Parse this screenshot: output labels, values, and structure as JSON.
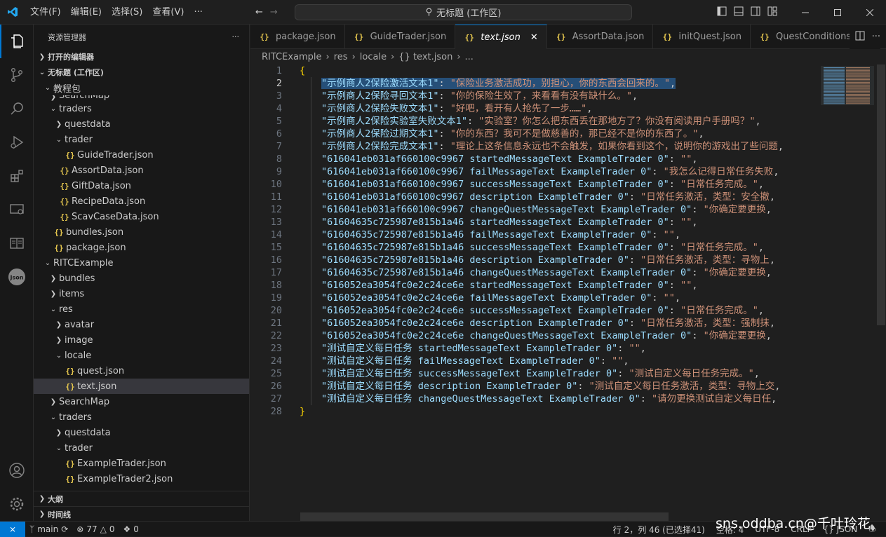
{
  "titlebar": {
    "menus": [
      "文件(F)",
      "编辑(E)",
      "选择(S)",
      "查看(V)",
      "···"
    ],
    "command_center": "无标题 (工作区)"
  },
  "sidebar": {
    "title": "资源管理器",
    "more": "···",
    "open_editors": "打开的编辑器",
    "workspace": "无标题 (工作区)",
    "tree": [
      {
        "label": "教程包",
        "kind": "folder",
        "open": true,
        "depth": 0
      },
      {
        "label": "SearchMap",
        "kind": "folder",
        "open": false,
        "depth": 1
      },
      {
        "label": "traders",
        "kind": "folder",
        "open": true,
        "depth": 1
      },
      {
        "label": "questdata",
        "kind": "folder",
        "open": false,
        "depth": 2
      },
      {
        "label": "trader",
        "kind": "folder",
        "open": true,
        "depth": 2
      },
      {
        "label": "GuideTrader.json",
        "kind": "json",
        "depth": 3
      },
      {
        "label": "AssortData.json",
        "kind": "json",
        "depth": 2
      },
      {
        "label": "GiftData.json",
        "kind": "json",
        "depth": 2
      },
      {
        "label": "RecipeData.json",
        "kind": "json",
        "depth": 2
      },
      {
        "label": "ScavCaseData.json",
        "kind": "json",
        "depth": 2
      },
      {
        "label": "bundles.json",
        "kind": "json",
        "depth": 1
      },
      {
        "label": "package.json",
        "kind": "json",
        "depth": 1
      },
      {
        "label": "RITCExample",
        "kind": "folder",
        "open": true,
        "depth": 0
      },
      {
        "label": "bundles",
        "kind": "folder",
        "open": false,
        "depth": 1
      },
      {
        "label": "items",
        "kind": "folder",
        "open": false,
        "depth": 1
      },
      {
        "label": "res",
        "kind": "folder",
        "open": true,
        "depth": 1
      },
      {
        "label": "avatar",
        "kind": "folder",
        "open": false,
        "depth": 2
      },
      {
        "label": "image",
        "kind": "folder",
        "open": false,
        "depth": 2
      },
      {
        "label": "locale",
        "kind": "folder",
        "open": true,
        "depth": 2
      },
      {
        "label": "quest.json",
        "kind": "json",
        "depth": 3
      },
      {
        "label": "text.json",
        "kind": "json",
        "depth": 3,
        "selected": true
      },
      {
        "label": "SearchMap",
        "kind": "folder",
        "open": false,
        "depth": 1
      },
      {
        "label": "traders",
        "kind": "folder",
        "open": true,
        "depth": 1
      },
      {
        "label": "questdata",
        "kind": "folder",
        "open": false,
        "depth": 2
      },
      {
        "label": "trader",
        "kind": "folder",
        "open": true,
        "depth": 2
      },
      {
        "label": "ExampleTrader.json",
        "kind": "json",
        "depth": 3
      },
      {
        "label": "ExampleTrader2.json",
        "kind": "json",
        "depth": 3
      }
    ],
    "outline": "大纲",
    "timeline": "时间线"
  },
  "tabs": [
    {
      "label": "package.json",
      "active": false
    },
    {
      "label": "GuideTrader.json",
      "active": false
    },
    {
      "label": "text.json",
      "active": true
    },
    {
      "label": "AssortData.json",
      "active": false
    },
    {
      "label": "initQuest.json",
      "active": false
    },
    {
      "label": "QuestConditions.js",
      "active": false
    }
  ],
  "breadcrumb": [
    "RITCExample",
    "res",
    "locale",
    "{} text.json",
    "..."
  ],
  "editor": {
    "current_line": 2,
    "lines": [
      {
        "n": "1",
        "open": "{"
      },
      {
        "n": "2",
        "key": "\"示例商人2保险激活文本1\"",
        "val": "\"保险业务激活成功，别担心，你的东西会回来的。\"",
        "selected": true
      },
      {
        "n": "3",
        "key": "\"示例商人2保险寻回文本1\"",
        "val": "\"你的保险生效了，来看看有没有缺什么。\""
      },
      {
        "n": "4",
        "key": "\"示例商人2保险失败文本1\"",
        "val": "\"好吧，看开有人抢先了一步……\""
      },
      {
        "n": "5",
        "key": "\"示例商人2保险实验室失败文本1\"",
        "val": "\"实验室？你怎么把东西丢在那地方了？你没有阅读用户手册吗？\""
      },
      {
        "n": "6",
        "key": "\"示例商人2保险过期文本1\"",
        "val": "\"你的东西？我可不是做慈善的，那已经不是你的东西了。\""
      },
      {
        "n": "7",
        "key": "\"示例商人2保险完成文本1\"",
        "val": "\"理论上这条信息永远也不会触发，如果你看到这个，说明你的游戏出了些问题"
      },
      {
        "n": "8",
        "key": "\"616041eb031af660100c9967 startedMessageText ExampleTrader 0\"",
        "val": "\"\""
      },
      {
        "n": "9",
        "key": "\"616041eb031af660100c9967 failMessageText ExampleTrader 0\"",
        "val": "\"我怎么记得日常任务失败"
      },
      {
        "n": "10",
        "key": "\"616041eb031af660100c9967 successMessageText ExampleTrader 0\"",
        "val": "\"日常任务完成。\""
      },
      {
        "n": "11",
        "key": "\"616041eb031af660100c9967 description ExampleTrader 0\"",
        "val": "\"日常任务激活，类型：安全撤"
      },
      {
        "n": "12",
        "key": "\"616041eb031af660100c9967 changeQuestMessageText ExampleTrader 0\"",
        "val": "\"你确定要更换"
      },
      {
        "n": "13",
        "key": "\"61604635c725987e815b1a46 startedMessageText ExampleTrader 0\"",
        "val": "\"\""
      },
      {
        "n": "14",
        "key": "\"61604635c725987e815b1a46 failMessageText ExampleTrader 0\"",
        "val": "\"\""
      },
      {
        "n": "15",
        "key": "\"61604635c725987e815b1a46 successMessageText ExampleTrader 0\"",
        "val": "\"日常任务完成。\""
      },
      {
        "n": "16",
        "key": "\"61604635c725987e815b1a46 description ExampleTrader 0\"",
        "val": "\"日常任务激活，类型：寻物上"
      },
      {
        "n": "17",
        "key": "\"61604635c725987e815b1a46 changeQuestMessageText ExampleTrader 0\"",
        "val": "\"你确定要更换"
      },
      {
        "n": "18",
        "key": "\"616052ea3054fc0e2c24ce6e startedMessageText ExampleTrader 0\"",
        "val": "\"\""
      },
      {
        "n": "19",
        "key": "\"616052ea3054fc0e2c24ce6e failMessageText ExampleTrader 0\"",
        "val": "\"\""
      },
      {
        "n": "20",
        "key": "\"616052ea3054fc0e2c24ce6e successMessageText ExampleTrader 0\"",
        "val": "\"日常任务完成。\""
      },
      {
        "n": "21",
        "key": "\"616052ea3054fc0e2c24ce6e description ExampleTrader 0\"",
        "val": "\"日常任务激活，类型：强制抹"
      },
      {
        "n": "22",
        "key": "\"616052ea3054fc0e2c24ce6e changeQuestMessageText ExampleTrader 0\"",
        "val": "\"你确定要更换"
      },
      {
        "n": "23",
        "key": "\"测试自定义每日任务 startedMessageText ExampleTrader 0\"",
        "val": "\"\""
      },
      {
        "n": "24",
        "key": "\"测试自定义每日任务 failMessageText ExampleTrader 0\"",
        "val": "\"\""
      },
      {
        "n": "25",
        "key": "\"测试自定义每日任务 successMessageText ExampleTrader 0\"",
        "val": "\"测试自定义每日任务完成。\""
      },
      {
        "n": "26",
        "key": "\"测试自定义每日任务 description ExampleTrader 0\"",
        "val": "\"测试自定义每日任务激活，类型：寻物上交"
      },
      {
        "n": "27",
        "key": "\"测试自定义每日任务 changeQuestMessageText ExampleTrader 0\"",
        "val": "\"请勿更换测试自定义每日任"
      },
      {
        "n": "28",
        "open": "}"
      }
    ]
  },
  "statusbar": {
    "branch": "main",
    "problems": "77",
    "warnings": "0",
    "ports": "0",
    "cursor": "行 2，列 46 (已选择41)",
    "spaces": "空格: 4",
    "encoding": "UTF-8",
    "eol": "CRLF",
    "language": "{} JSON"
  },
  "watermark": "sns.oddba.cn@千叶玲花",
  "colors": {
    "accent": "#0078d4",
    "key": "#9cdcfe",
    "string": "#ce9178",
    "json_icon": "#e8c94f",
    "selection": "#264f78"
  }
}
